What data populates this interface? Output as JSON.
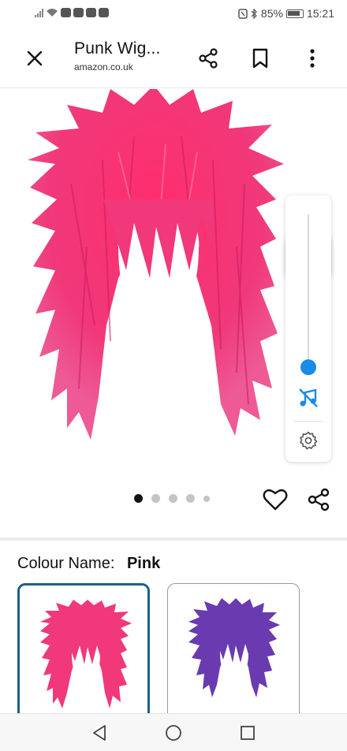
{
  "status": {
    "battery": "85%",
    "time": "15:21"
  },
  "toolbar": {
    "title": "Punk Wig...",
    "url": "amazon.co.uk"
  },
  "icons": {
    "close": "close-icon",
    "share": "share-icon",
    "bookmark": "bookmark-icon",
    "more": "more-vertical-icon",
    "bell": "bell-icon",
    "music_off": "music-off-icon",
    "settings": "gear-icon",
    "wishlist": "heart-icon",
    "nav_back": "triangle-back-icon",
    "nav_home": "circle-home-icon",
    "nav_recent": "square-recent-icon"
  },
  "carousel": {
    "count": 5,
    "active_index": 0
  },
  "volume_level": 0.0,
  "colour": {
    "label": "Colour Name:",
    "value": "Pink",
    "options": [
      "Pink",
      "Purple"
    ]
  },
  "colors": {
    "accent_blue": "#1a8be6",
    "selected_border": "#1f5f8b",
    "wig_pink": "#f0387a",
    "wig_purple": "#6a3bb0"
  }
}
